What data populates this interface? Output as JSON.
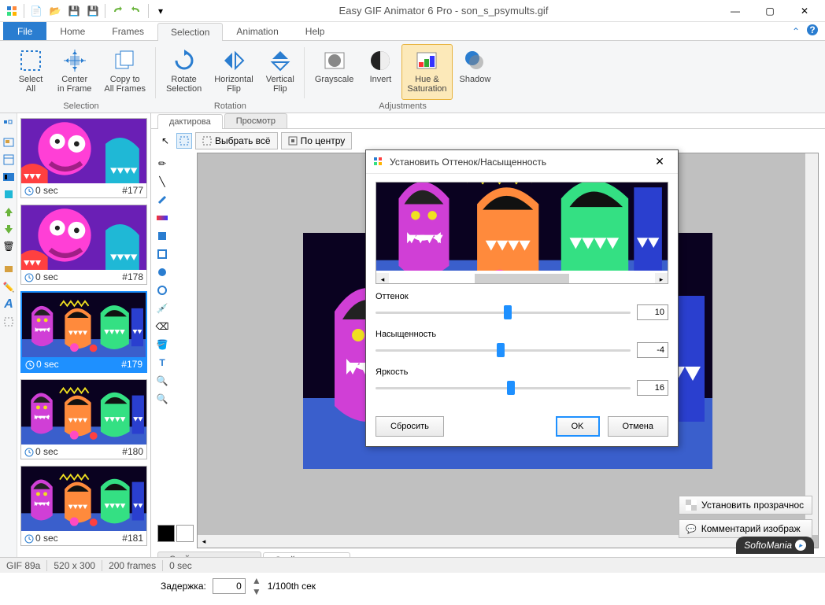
{
  "window": {
    "title": "Easy GIF Animator 6 Pro - son_s_psymults.gif"
  },
  "menu": {
    "file": "File",
    "tabs": [
      "Home",
      "Frames",
      "Selection",
      "Animation",
      "Help"
    ],
    "active_tab": "Selection"
  },
  "ribbon": {
    "groups": [
      {
        "name": "Selection",
        "buttons": [
          {
            "label": "Select\nAll",
            "icon": "select-all"
          },
          {
            "label": "Center\nin Frame",
            "icon": "center"
          },
          {
            "label": "Copy to\nAll Frames",
            "icon": "copy-all"
          }
        ]
      },
      {
        "name": "Rotation",
        "buttons": [
          {
            "label": "Rotate\nSelection",
            "icon": "rotate"
          },
          {
            "label": "Horizontal\nFlip",
            "icon": "hflip"
          },
          {
            "label": "Vertical\nFlip",
            "icon": "vflip"
          }
        ]
      },
      {
        "name": "Adjustments",
        "buttons": [
          {
            "label": "Grayscale",
            "icon": "grayscale"
          },
          {
            "label": "Invert",
            "icon": "invert"
          },
          {
            "label": "Hue &\nSaturation",
            "icon": "hue",
            "active": true
          },
          {
            "label": "Shadow",
            "icon": "shadow"
          }
        ]
      }
    ]
  },
  "frames": [
    {
      "time": "0 sec",
      "index": "#177",
      "variant": "pink"
    },
    {
      "time": "0 sec",
      "index": "#178",
      "variant": "pink"
    },
    {
      "time": "0 sec",
      "index": "#179",
      "variant": "monsters",
      "selected": true
    },
    {
      "time": "0 sec",
      "index": "#180",
      "variant": "monsters"
    },
    {
      "time": "0 sec",
      "index": "#181",
      "variant": "monsters"
    }
  ],
  "editor": {
    "tabs": [
      "дактирова",
      "Просмотр"
    ],
    "active_tab": 0,
    "actions": {
      "select_all": "Выбрать всё",
      "center": "По центру"
    }
  },
  "properties": {
    "tabs": [
      "Свойства анимации",
      "Свойства кадра"
    ],
    "active_tab": 1,
    "delay_label": "Задержка:",
    "delay_value": "0",
    "delay_unit": "1/100th сек",
    "transparency_btn": "Установить прозрачнос",
    "comment_btn": "Комментарий изображ"
  },
  "statusbar": {
    "format": "GIF 89a",
    "size": "520 x 300",
    "frames": "200 frames",
    "time": "0 sec"
  },
  "dialog": {
    "title": "Установить Оттенок/Насыщенность",
    "sliders": [
      {
        "label": "Оттенок",
        "value": "10",
        "pos": 52
      },
      {
        "label": "Насыщенность",
        "value": "-4",
        "pos": 49
      },
      {
        "label": "Яркость",
        "value": "16",
        "pos": 53
      }
    ],
    "buttons": {
      "reset": "Сбросить",
      "ok": "OK",
      "cancel": "Отмена"
    }
  },
  "watermark": "SoftoMania"
}
